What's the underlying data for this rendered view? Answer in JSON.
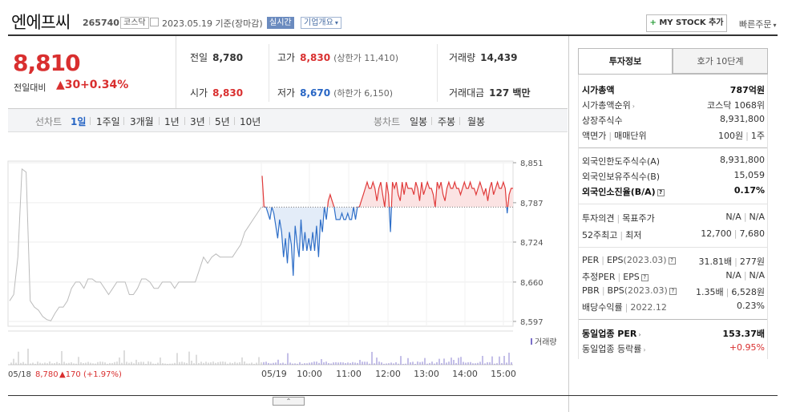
{
  "header": {
    "name": "엔에프씨",
    "code": "265740",
    "market": "코스닥",
    "date": "2023.05.19 기준(장마감)",
    "realtime": "실시간",
    "overview": "기업개요",
    "mystock": "MY STOCK 추가",
    "quick_order": "빠른주문"
  },
  "price": {
    "current": "8,810",
    "prev_label": "전일대비",
    "change": "30",
    "rate": "+0.34%"
  },
  "stats": {
    "prev_close": {
      "label": "전일",
      "value": "8,780"
    },
    "high": {
      "label": "고가",
      "value": "8,830",
      "sub": "(상한가 11,410)"
    },
    "volume": {
      "label": "거래량",
      "value": "14,439"
    },
    "open": {
      "label": "시가",
      "value": "8,830"
    },
    "low": {
      "label": "저가",
      "value": "8,670",
      "sub": "(하한가 6,150)"
    },
    "amount": {
      "label": "거래대금",
      "value": "127 백만"
    }
  },
  "tabs": {
    "line_label": "선차트",
    "line": [
      "1일",
      "1주일",
      "3개월",
      "1년",
      "3년",
      "5년",
      "10년"
    ],
    "candle_label": "봉차트",
    "candle": [
      "일봉",
      "주봉",
      "월봉"
    ]
  },
  "chart_data": {
    "type": "line",
    "y_ticks": [
      "8,851",
      "8,787",
      "8,724",
      "8,660",
      "8,597"
    ],
    "ylim": [
      8597,
      8851
    ],
    "x_ticks": [
      "05/18",
      "05/19",
      "10:00",
      "11:00",
      "12:00",
      "13:00",
      "14:00",
      "15:00"
    ],
    "baseline": 8780,
    "prev_summary": {
      "date": "05/18",
      "close": "8,780",
      "change": "▲170 (+1.97%)"
    },
    "volume_label": "거래량",
    "prev_day_series": [
      8630,
      8640,
      8700,
      8841,
      8836,
      8630,
      8620,
      8615,
      8605,
      8600,
      8598,
      8610,
      8620,
      8620,
      8630,
      8650,
      8660,
      8660,
      8650,
      8665,
      8665,
      8660,
      8660,
      8650,
      8640,
      8650,
      8660,
      8660,
      8660,
      8640,
      8640,
      8650,
      8665,
      8665,
      8660,
      8650,
      8650,
      8660,
      8660,
      8660,
      8650,
      8660,
      8660,
      8660,
      8660,
      8660,
      8680,
      8700,
      8690,
      8700,
      8705,
      8700,
      8700,
      8700,
      8700,
      8710,
      8720,
      8740,
      8750,
      8760,
      8770,
      8780
    ],
    "today_series": [
      8830,
      8780,
      8780,
      8770,
      8760,
      8780,
      8770,
      8750,
      8730,
      8760,
      8740,
      8700,
      8730,
      8690,
      8740,
      8720,
      8670,
      8750,
      8720,
      8700,
      8760,
      8710,
      8740,
      8710,
      8730,
      8710,
      8740,
      8710,
      8750,
      8700,
      8760,
      8740,
      8780,
      8760,
      8790,
      8800,
      8790,
      8780,
      8760,
      8760,
      8760,
      8770,
      8760,
      8760,
      8770,
      8760,
      8760,
      8780,
      8760,
      8780,
      8780,
      8790,
      8800,
      8810,
      8820,
      8810,
      8810,
      8820,
      8810,
      8790,
      8810,
      8820,
      8800,
      8780,
      8820,
      8800,
      8740,
      8820,
      8810,
      8820,
      8800,
      8790,
      8820,
      8800,
      8820,
      8810,
      8810,
      8810,
      8800,
      8820,
      8810,
      8790,
      8820,
      8800,
      8810,
      8820,
      8810,
      8810,
      8800,
      8780,
      8820,
      8810,
      8820,
      8800,
      8790,
      8810,
      8820,
      8810,
      8810,
      8820,
      8810,
      8810,
      8800,
      8810,
      8820,
      8810,
      8810,
      8820,
      8810,
      8810,
      8800,
      8810,
      8820,
      8810,
      8800,
      8810,
      8790,
      8810,
      8820,
      8800,
      8810,
      8820,
      8810,
      8810,
      8820,
      8810,
      8770,
      8800,
      8810,
      8810
    ]
  },
  "side": {
    "tab1": "투자정보",
    "tab2": "호가 10단계",
    "market_cap": {
      "label": "시가총액",
      "value": "787억원"
    },
    "cap_rank": {
      "label": "시가총액순위",
      "value": "코스닥 1068위"
    },
    "shares": {
      "label": "상장주식수",
      "value": "8,931,800"
    },
    "par": {
      "label": "액면가",
      "label2": "매매단위",
      "value": "100원",
      "value2": "1주"
    },
    "foreign_limit": {
      "label": "외국인한도주식수(A)",
      "value": "8,931,800"
    },
    "foreign_hold": {
      "label": "외국인보유주식수(B)",
      "value": "15,059"
    },
    "foreign_ratio": {
      "label": "외국인소진율(B/A)",
      "value": "0.17%"
    },
    "opinion": {
      "label": "투자의견",
      "label2": "목표주가",
      "value": "N/A",
      "value2": "N/A"
    },
    "week52": {
      "label": "52주최고",
      "label2": "최저",
      "value": "12,700",
      "value2": "7,680"
    },
    "per": {
      "label": "PER",
      "label2": "EPS",
      "period": "(2023.03)",
      "value": "31.81배",
      "value2": "277원"
    },
    "est_per": {
      "label": "추정PER",
      "label2": "EPS",
      "value": "N/A",
      "value2": "N/A"
    },
    "pbr": {
      "label": "PBR",
      "label2": "BPS",
      "period": "(2023.03)",
      "value": "1.35배",
      "value2": "6,528원"
    },
    "dividend": {
      "label": "배당수익률",
      "period": "2022.12",
      "value": "0.23%"
    },
    "sector_per": {
      "label": "동일업종 PER",
      "value": "153.37배"
    },
    "sector_rate": {
      "label": "동일업종 등락률",
      "value": "+0.95%"
    }
  }
}
